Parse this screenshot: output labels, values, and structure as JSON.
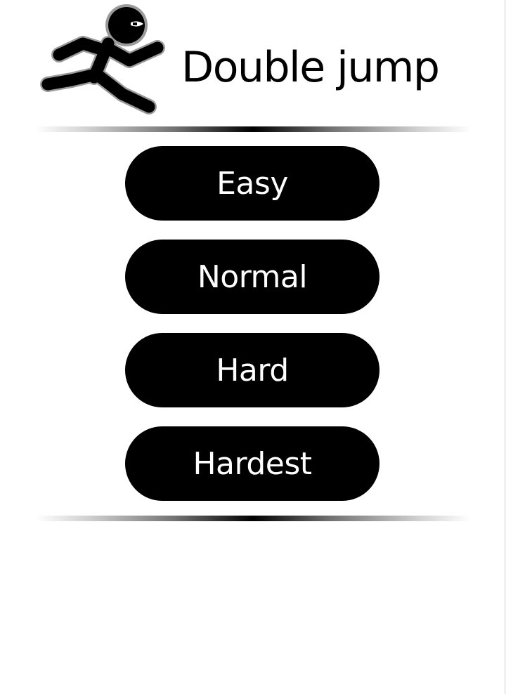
{
  "header": {
    "title": "Double jump",
    "logo_icon": "stick-figure-runner-icon"
  },
  "menu": {
    "buttons": [
      {
        "label": "Easy"
      },
      {
        "label": "Normal"
      },
      {
        "label": "Hard"
      },
      {
        "label": "Hardest"
      }
    ]
  },
  "colors": {
    "background": "#ffffff",
    "button_fill": "#000000",
    "button_text": "#ffffff",
    "title_text": "#000000"
  }
}
